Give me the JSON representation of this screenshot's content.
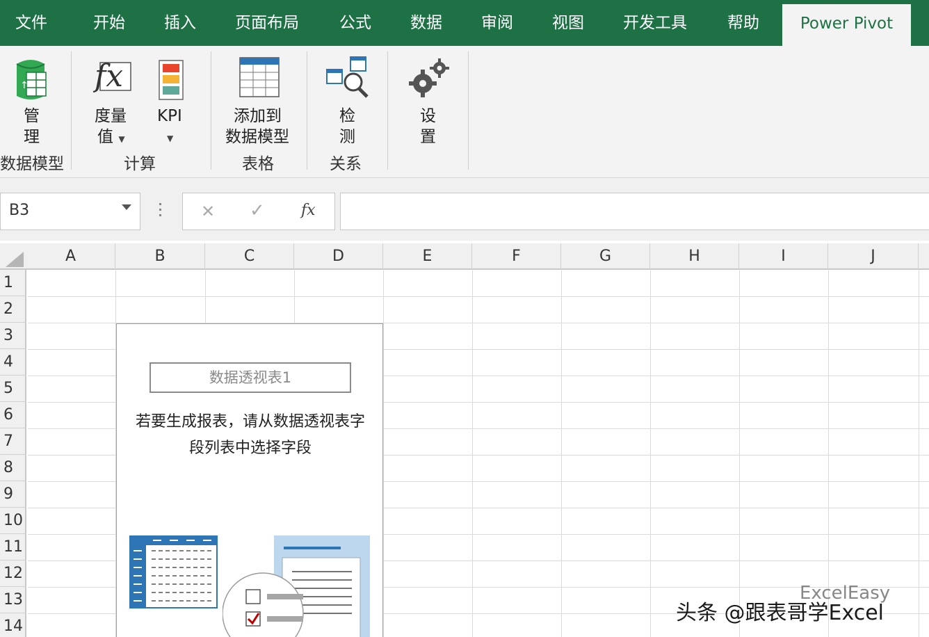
{
  "ribbon_tabs": [
    "文件",
    "开始",
    "插入",
    "页面布局",
    "公式",
    "数据",
    "审阅",
    "视图",
    "开发工具",
    "帮助",
    "Power Pivot"
  ],
  "active_tab": "Power Pivot",
  "ribbon": {
    "manage": {
      "line1": "管",
      "line2": "理"
    },
    "measures": {
      "line1": "度量",
      "line2": "值"
    },
    "kpi": {
      "label": "KPI"
    },
    "add_to_model": {
      "line1": "添加到",
      "line2": "数据模型"
    },
    "detect": {
      "line1": "检",
      "line2": "测"
    },
    "settings": {
      "line1": "设",
      "line2": "置"
    },
    "groups": {
      "data_model": "数据模型",
      "calculations": "计算",
      "tables": "表格",
      "relationships": "关系"
    }
  },
  "formula_bar": {
    "name_box": "B3",
    "cancel_glyph": "✕",
    "enter_glyph": "✓",
    "fx": "fx",
    "formula": ""
  },
  "columns": [
    "A",
    "B",
    "C",
    "D",
    "E",
    "F",
    "G",
    "H",
    "I",
    "J"
  ],
  "rows": [
    "1",
    "2",
    "3",
    "4",
    "5",
    "6",
    "7",
    "8",
    "9",
    "10",
    "11",
    "12",
    "13",
    "14"
  ],
  "pivot": {
    "name": "数据透视表1",
    "message_line1": "若要生成报表，请从数据透视表字",
    "message_line2": "段列表中选择字段"
  },
  "watermark": {
    "main": "头条 @跟表哥学Excel",
    "sub": "ExcelEasy"
  },
  "colors": {
    "ribbon_green": "#1e7145",
    "ribbon_bg": "#f3f3f3",
    "grid_line": "#dadada",
    "icon_blue": "#2e75b6"
  }
}
